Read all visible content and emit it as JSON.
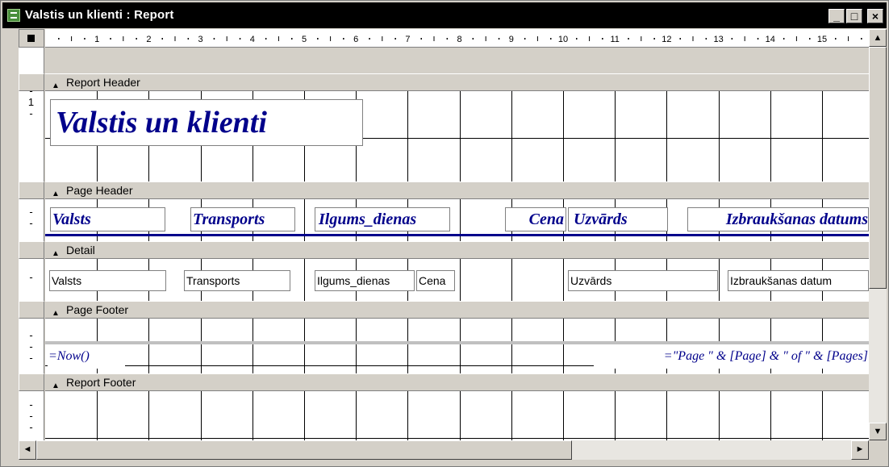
{
  "window": {
    "title": "Valstis un klienti : Report"
  },
  "title_buttons": {
    "minimize": "_",
    "maximize": "□",
    "close": "×"
  },
  "ruler": {
    "labels": [
      "1",
      "2",
      "3",
      "4",
      "5",
      "6",
      "7",
      "8",
      "9",
      "10",
      "11",
      "12",
      "13",
      "14",
      "15"
    ]
  },
  "vruler": {
    "label": "1"
  },
  "bands": {
    "report_header": "Report Header",
    "page_header": "Page Header",
    "detail": "Detail",
    "page_footer": "Page Footer",
    "report_footer": "Report Footer"
  },
  "report_header": {
    "title": "Valstis un klienti"
  },
  "page_header": {
    "labels": [
      "Valsts",
      "Transports",
      "Ilgums_dienas",
      "Cena",
      "Uzvārds",
      "Izbraukšanas datums"
    ]
  },
  "detail": {
    "fields": [
      "Valsts",
      "Transports",
      "Ilgums_dienas",
      "Cena",
      "Uzvārds",
      "Izbraukšanas datum"
    ]
  },
  "page_footer": {
    "now": "=Now()",
    "page_expr": "=\"Page \" & [Page] & \" of \" & [Pages]"
  },
  "icons": {
    "band_arrow": "band-arrow-icon",
    "scroll_up": "▲",
    "scroll_down": "▼",
    "scroll_left": "◄",
    "scroll_right": "►"
  },
  "colors": {
    "label_text": "#00008b",
    "window_bg": "#d4d0c8"
  }
}
